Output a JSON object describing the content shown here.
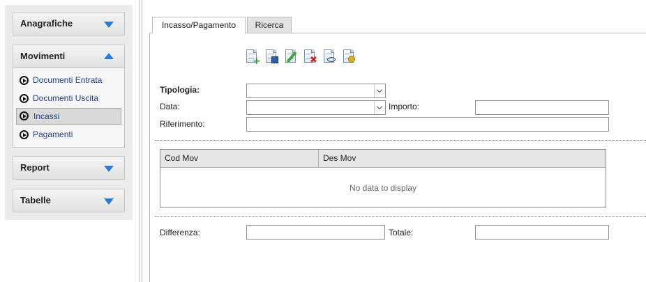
{
  "sidebar": {
    "sections": [
      {
        "label": "Anagrafiche",
        "expanded": false
      },
      {
        "label": "Movimenti",
        "expanded": true
      },
      {
        "label": "Report",
        "expanded": false
      },
      {
        "label": "Tabelle",
        "expanded": false
      }
    ],
    "movimenti_items": [
      {
        "label": "Documenti Entrata",
        "selected": false
      },
      {
        "label": "Documenti Uscita",
        "selected": false
      },
      {
        "label": "Incassi",
        "selected": true
      },
      {
        "label": "Pagamenti",
        "selected": false
      }
    ],
    "accent_color": "#2a7ad8",
    "link_color": "#1f3f8f"
  },
  "tabs": [
    {
      "label": "Incasso/Pagamento",
      "active": true
    },
    {
      "label": "Ricerca",
      "active": false
    }
  ],
  "toolbar": {
    "icons": [
      "new-document-icon",
      "save-document-icon",
      "edit-document-icon",
      "delete-document-icon",
      "view-document-icon",
      "document-settings-icon"
    ]
  },
  "form": {
    "tipologia": {
      "label": "Tipologia:",
      "value": ""
    },
    "data": {
      "label": "Data:",
      "value": ""
    },
    "importo": {
      "label": "Importo:",
      "value": ""
    },
    "riferimento": {
      "label": "Riferimento:",
      "value": ""
    },
    "differenza": {
      "label": "Differenza:",
      "value": ""
    },
    "totale": {
      "label": "Totale:",
      "value": ""
    }
  },
  "grid": {
    "columns": [
      "Cod Mov",
      "Des Mov"
    ],
    "rows": [],
    "empty_text": "No data to display"
  }
}
